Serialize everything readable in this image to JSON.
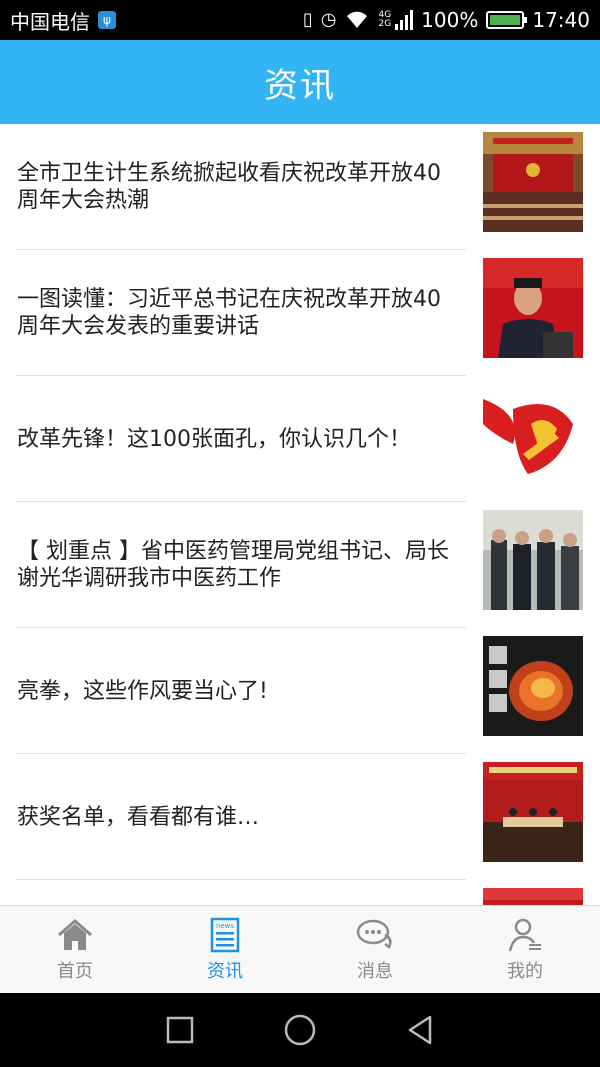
{
  "status_bar": {
    "carrier": "中国电信",
    "network_label_top": "4G",
    "network_label_bottom": "2G",
    "battery_percent": "100%",
    "battery_level": 1.0,
    "time": "17:40",
    "icons": [
      "usb-icon",
      "vibrate-icon",
      "alarm-icon",
      "wifi-icon",
      "signal-icon",
      "battery-icon"
    ]
  },
  "header": {
    "title": "资讯",
    "background": "#33b5f5"
  },
  "news": [
    {
      "title": "全市卫生计生系统掀起收看庆祝改革开放40周年大会热潮",
      "thumb": "conference-hall-photo"
    },
    {
      "title": "一图读懂：习近平总书记在庆祝改革开放40周年大会发表的重要讲话",
      "thumb": "speaker-photo"
    },
    {
      "title": "改革先锋！这100张面孔，你认识几个！",
      "thumb": "party-emblem-photo"
    },
    {
      "title": "【 划重点 】省中医药管理局党组书记、局长谢光华调研我市中医药工作",
      "thumb": "group-visit-photo"
    },
    {
      "title": "亮拳，这些作风要当心了!",
      "thumb": "fire-fist-photo"
    },
    {
      "title": "获奖名单，看看都有谁…",
      "thumb": "award-stage-photo"
    },
    {
      "title": "",
      "thumb": "red-banner-photo"
    }
  ],
  "tabs": [
    {
      "label": "首页",
      "icon": "home-icon",
      "active": false
    },
    {
      "label": "资讯",
      "icon": "news-icon",
      "active": true
    },
    {
      "label": "消息",
      "icon": "chat-icon",
      "active": false
    },
    {
      "label": "我的",
      "icon": "profile-icon",
      "active": false
    }
  ],
  "news_icon_text": "news",
  "colors": {
    "active_tab": "#1e90e6",
    "inactive_tab": "#8a8a8a"
  },
  "system_nav": [
    "back-square-icon",
    "home-circle-icon",
    "back-triangle-icon"
  ]
}
